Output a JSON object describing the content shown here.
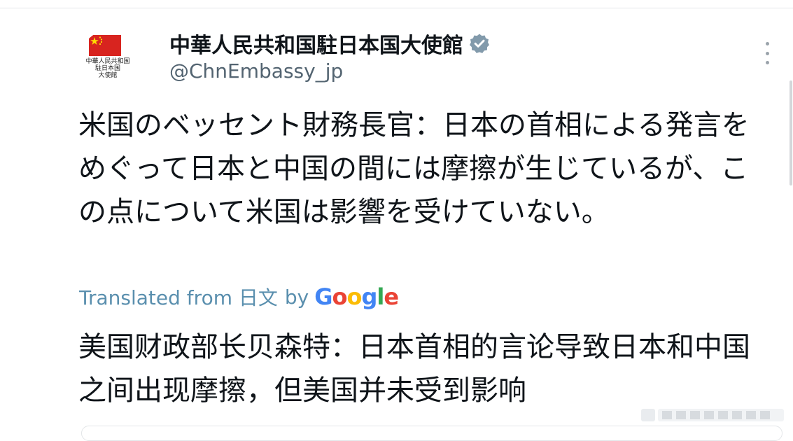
{
  "account": {
    "display_name": "中華人民共和国駐日本国大使館",
    "handle": "@ChnEmbassy_jp",
    "avatar_caption": [
      "中華人民共和国",
      "駐日本国",
      "大使館"
    ],
    "verified": true
  },
  "tweet": {
    "original_text": "米国のベッセント財務長官：日本の首相による発言をめぐって日本と中国の間には摩擦が生じているが、この点について米国は影響を受けていない。",
    "translated_from_label": "Translated from 日文",
    "by_label": "by",
    "translation_provider": "Google",
    "translated_text": "美国财政部长贝森特：日本首相的言论导致日本和中国之间出现摩擦，但美国并未受到影响"
  },
  "icons": {
    "verified": "verified-badge-icon",
    "more": "more-options-icon"
  },
  "colors": {
    "verified_badge": "#829aab",
    "translate_link": "#5a8fae",
    "flag_red": "#d8241f",
    "flag_star": "#ffde00"
  }
}
